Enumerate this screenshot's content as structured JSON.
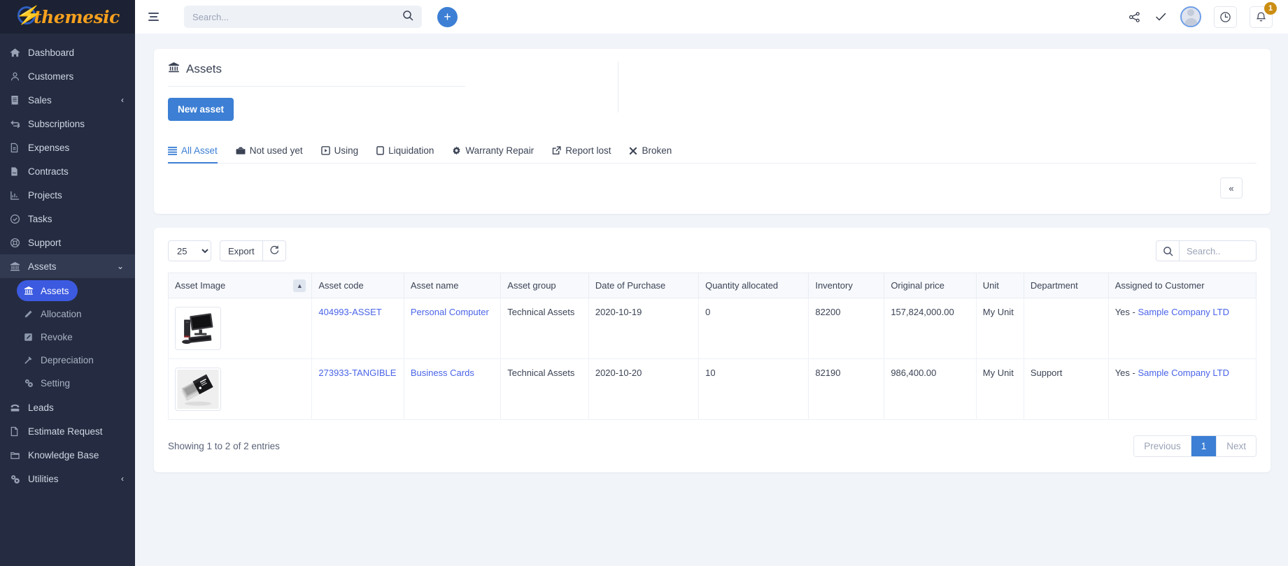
{
  "brand": {
    "name": "themesic",
    "logo_icon": "lightning-bolt-icon",
    "accent": "#f5a01e"
  },
  "sidebar": {
    "items": [
      {
        "label": "Dashboard",
        "icon": "home-icon",
        "caret": ""
      },
      {
        "label": "Customers",
        "icon": "user-icon",
        "caret": ""
      },
      {
        "label": "Sales",
        "icon": "receipt-icon",
        "caret": "‹"
      },
      {
        "label": "Subscriptions",
        "icon": "refresh-cycle-icon",
        "caret": ""
      },
      {
        "label": "Expenses",
        "icon": "document-icon",
        "caret": ""
      },
      {
        "label": "Contracts",
        "icon": "contract-icon",
        "caret": ""
      },
      {
        "label": "Projects",
        "icon": "chart-icon",
        "caret": ""
      },
      {
        "label": "Tasks",
        "icon": "check-circle-icon",
        "caret": ""
      },
      {
        "label": "Support",
        "icon": "lifebuoy-icon",
        "caret": ""
      }
    ],
    "assets_group": {
      "label": "Assets",
      "icon": "bank-icon",
      "caret": "⌄"
    },
    "assets_children": [
      {
        "label": "Assets",
        "icon": "bank-icon",
        "active": true
      },
      {
        "label": "Allocation",
        "icon": "pencil-icon",
        "active": false
      },
      {
        "label": "Revoke",
        "icon": "edit-square-icon",
        "active": false
      },
      {
        "label": "Depreciation",
        "icon": "hammer-icon",
        "active": false
      },
      {
        "label": "Setting",
        "icon": "gears-icon",
        "active": false
      }
    ],
    "items_after": [
      {
        "label": "Leads",
        "icon": "telephone-icon",
        "caret": ""
      },
      {
        "label": "Estimate Request",
        "icon": "file-icon",
        "caret": ""
      },
      {
        "label": "Knowledge Base",
        "icon": "folder-icon",
        "caret": ""
      },
      {
        "label": "Utilities",
        "icon": "gears-icon",
        "caret": "‹"
      }
    ]
  },
  "topbar": {
    "menu_icon": "hamburger-icon",
    "search_placeholder": "Search...",
    "search_value": "",
    "search_icon": "search-icon",
    "add_label": "+",
    "share_icon": "share-icon",
    "check_icon": "check-icon",
    "avatar_icon": "user-avatar",
    "clock_icon": "clock-icon",
    "bell_icon": "bell-icon",
    "bell_badge": "1"
  },
  "page": {
    "title": "Assets",
    "title_icon": "bank-icon",
    "new_asset_label": "New asset",
    "collapse_label": "«",
    "tabs": [
      {
        "label": "All Asset",
        "icon": "list-icon",
        "active": true
      },
      {
        "label": "Not used yet",
        "icon": "briefcase-icon",
        "active": false
      },
      {
        "label": "Using",
        "icon": "play-box-icon",
        "active": false
      },
      {
        "label": "Liquidation",
        "icon": "tablet-icon",
        "active": false
      },
      {
        "label": "Warranty Repair",
        "icon": "gear-icon",
        "active": false
      },
      {
        "label": "Report lost",
        "icon": "external-link-icon",
        "active": false
      },
      {
        "label": "Broken",
        "icon": "x-icon",
        "active": false
      }
    ]
  },
  "table": {
    "page_size": "25",
    "page_size_options": [
      "25"
    ],
    "export_label": "Export",
    "refresh_icon": "refresh-icon",
    "search_icon": "search-icon",
    "search_placeholder": "Search..",
    "search_value": "",
    "sort_icon": "chevron-up-icon",
    "columns": [
      "Asset Image",
      "Asset code",
      "Asset name",
      "Asset group",
      "Date of Purchase",
      "Quantity allocated",
      "Inventory",
      "Original price",
      "Unit",
      "Department",
      "Assigned to Customer"
    ],
    "rows": [
      {
        "image": "desktop-computer-photo",
        "code": "404993-ASSET",
        "name": "Personal Computer",
        "group": "Technical Assets",
        "purchase_date": "2020-10-19",
        "quantity_allocated": "0",
        "inventory": "82200",
        "original_price": "157,824,000.00",
        "unit": "My Unit",
        "department": "",
        "assigned_prefix": "Yes - ",
        "assigned_customer": "Sample Company LTD"
      },
      {
        "image": "business-cards-photo",
        "code": "273933-TANGIBLE",
        "name": "Business Cards",
        "group": "Technical Assets",
        "purchase_date": "2020-10-20",
        "quantity_allocated": "10",
        "inventory": "82190",
        "original_price": "986,400.00",
        "unit": "My Unit",
        "department": "Support",
        "assigned_prefix": "Yes - ",
        "assigned_customer": "Sample Company LTD"
      }
    ],
    "showing_text": "Showing 1 to 2 of 2 entries",
    "pagination": {
      "previous": "Previous",
      "current": "1",
      "next": "Next"
    }
  },
  "colors": {
    "primary": "#3c7fd4",
    "active_nav": "#3c5ae0",
    "link": "#4a64e8",
    "sidebar_bg": "#252c41",
    "badge": "#cb8e12"
  }
}
